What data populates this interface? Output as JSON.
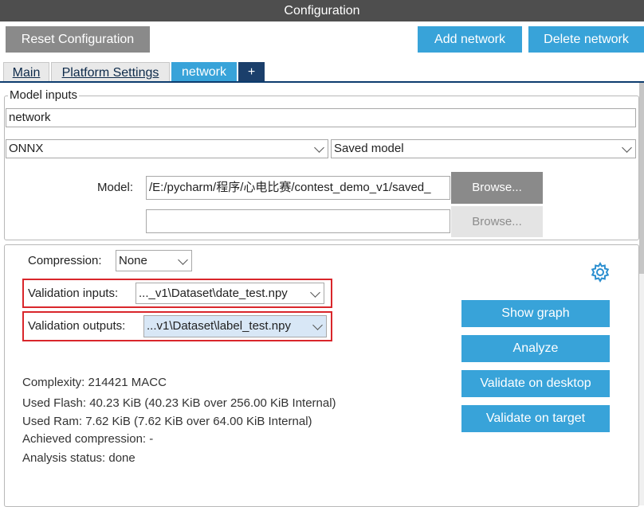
{
  "window": {
    "title": "Configuration"
  },
  "toolbar": {
    "reset_label": "Reset Configuration",
    "add_network_label": "Add network",
    "delete_network_label": "Delete network"
  },
  "tabs": [
    {
      "label": "Main",
      "active": false
    },
    {
      "label": "Platform Settings",
      "active": false
    },
    {
      "label": "network",
      "active": true
    },
    {
      "label": "+",
      "active": false
    }
  ],
  "model_inputs": {
    "legend": "Model inputs",
    "name_value": "network",
    "framework_value": "ONNX",
    "model_type_value": "Saved model",
    "model_label": "Model:",
    "model_path_value": "/E:/pycharm/程序/心电比赛/contest_demo_v1/saved_",
    "second_path_value": "",
    "browse_label": "Browse...",
    "browse2_label": "Browse..."
  },
  "analysis": {
    "compression_label": "Compression:",
    "compression_value": "None",
    "validation_inputs_label": "Validation inputs:",
    "validation_inputs_value": "..._v1\\Dataset\\date_test.npy",
    "validation_outputs_label": "Validation outputs:",
    "validation_outputs_value": "...v1\\Dataset\\label_test.npy",
    "complexity": "Complexity:  214421 MACC",
    "used_flash": "Used Flash: 40.23 KiB (40.23 KiB over 256.00 KiB Internal)",
    "used_ram": "Used Ram: 7.62 KiB (7.62 KiB over 64.00 KiB Internal)",
    "achieved_compression": "Achieved compression: -",
    "analysis_status": "Analysis status: done"
  },
  "actions": {
    "show_graph_label": "Show graph",
    "analyze_label": "Analyze",
    "validate_desktop_label": "Validate on desktop",
    "validate_target_label": "Validate on target"
  },
  "icons": {
    "settings": "gear-icon"
  },
  "colors": {
    "accent": "#38a3d9",
    "titlebar": "#4e4e4e",
    "highlight": "#d9262b"
  }
}
